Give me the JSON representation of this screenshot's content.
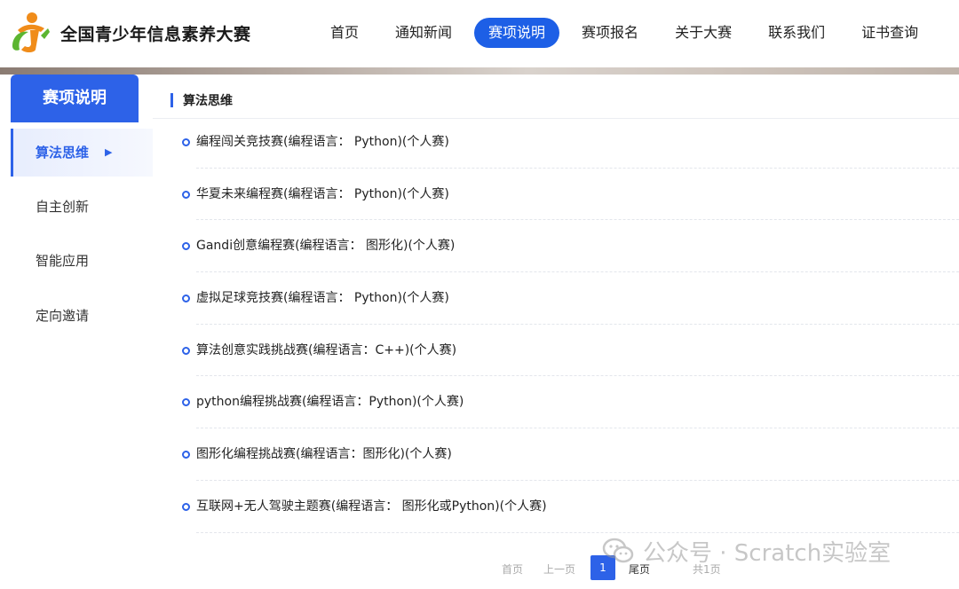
{
  "header": {
    "site_title": "全国青少年信息素养大赛",
    "nav": [
      {
        "label": "首页"
      },
      {
        "label": "通知新闻"
      },
      {
        "label": "赛项说明",
        "active": true
      },
      {
        "label": "赛项报名"
      },
      {
        "label": "关于大赛"
      },
      {
        "label": "联系我们"
      },
      {
        "label": "证书查询"
      }
    ]
  },
  "sidebar": {
    "title": "赛项说明",
    "items": [
      {
        "label": "算法思维",
        "active": true
      },
      {
        "label": "自主创新"
      },
      {
        "label": "智能应用"
      },
      {
        "label": "定向邀请"
      }
    ]
  },
  "main": {
    "section_title": "算法思维",
    "items": [
      {
        "text": "编程闯关竞技赛(编程语言： Python)(个人赛)"
      },
      {
        "text": "华夏未来编程赛(编程语言： Python)(个人赛)"
      },
      {
        "text": "Gandi创意编程赛(编程语言： 图形化)(个人赛)"
      },
      {
        "text": "虚拟足球竞技赛(编程语言： Python)(个人赛)"
      },
      {
        "text": "算法创意实践挑战赛(编程语言：C++)(个人赛)"
      },
      {
        "text": "python编程挑战赛(编程语言：Python)(个人赛)"
      },
      {
        "text": "图形化编程挑战赛(编程语言：图形化)(个人赛)"
      },
      {
        "text": "互联网+无人驾驶主题赛(编程语言： 图形化或Python)(个人赛)"
      }
    ]
  },
  "pagination": {
    "first": "首页",
    "prev": "上一页",
    "current": "1",
    "last": "尾页",
    "total": "共1页"
  },
  "watermark": {
    "text": "公众号 · Scratch实验室"
  },
  "colors": {
    "accent": "#2d62e8",
    "nav_active": "#1d5fe6",
    "logo_orange": "#f08c1a",
    "logo_green": "#5cb531"
  },
  "icons": {
    "logo": "runner-logo-icon",
    "sidebar_arrow": "caret-right-icon",
    "list_bullet": "circle-bullet-icon",
    "watermark": "wechat-icon"
  }
}
